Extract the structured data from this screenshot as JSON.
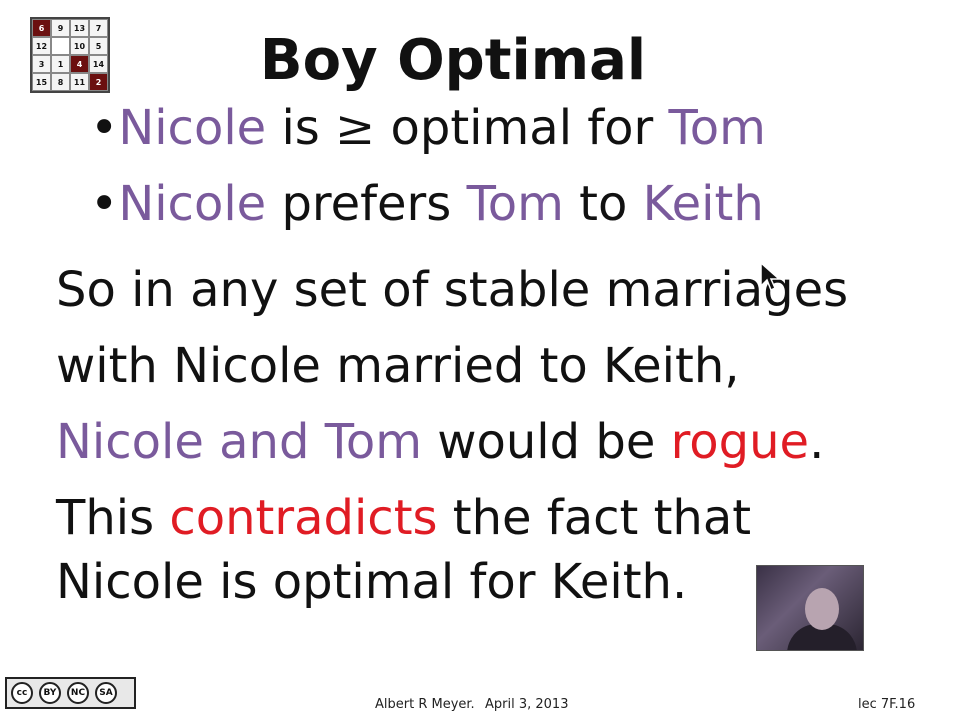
{
  "puzzle": {
    "cells": [
      "6",
      "9",
      "13",
      "7",
      "12",
      "",
      "10",
      "5",
      "3",
      "1",
      "4",
      "14",
      "15",
      "8",
      "11",
      "2"
    ]
  },
  "title": "Boy Optimal",
  "bullets": [
    {
      "dot": "•",
      "a": "Nicole",
      "b": " is ",
      "geq": "≥",
      "c": " optimal for ",
      "d": "Tom"
    },
    {
      "dot": "•",
      "a": "Nicole",
      "b": " prefers ",
      "c": "Tom",
      "d": " to ",
      "e": "Keith"
    }
  ],
  "paragraph": {
    "line1": "So in any set of stable marriages",
    "line2": "with Nicole married to Keith,",
    "line3_a": "Nicole and Tom",
    "line3_b": " would be ",
    "line3_c": "rogue",
    "line3_d": ".",
    "line4_a": "This ",
    "line4_b": "contradicts",
    "line4_c": " the fact that",
    "line5": "Nicole is optimal for Keith."
  },
  "license": {
    "cc": "cc",
    "by": "BY",
    "nc": "NC",
    "sa": "SA"
  },
  "footer": {
    "author": "Albert R Meyer.",
    "date": "April 3, 2013",
    "slide": "lec 7F.16"
  },
  "colors": {
    "accent_purple": "#7a5a9c",
    "accent_red": "#e01c24"
  }
}
